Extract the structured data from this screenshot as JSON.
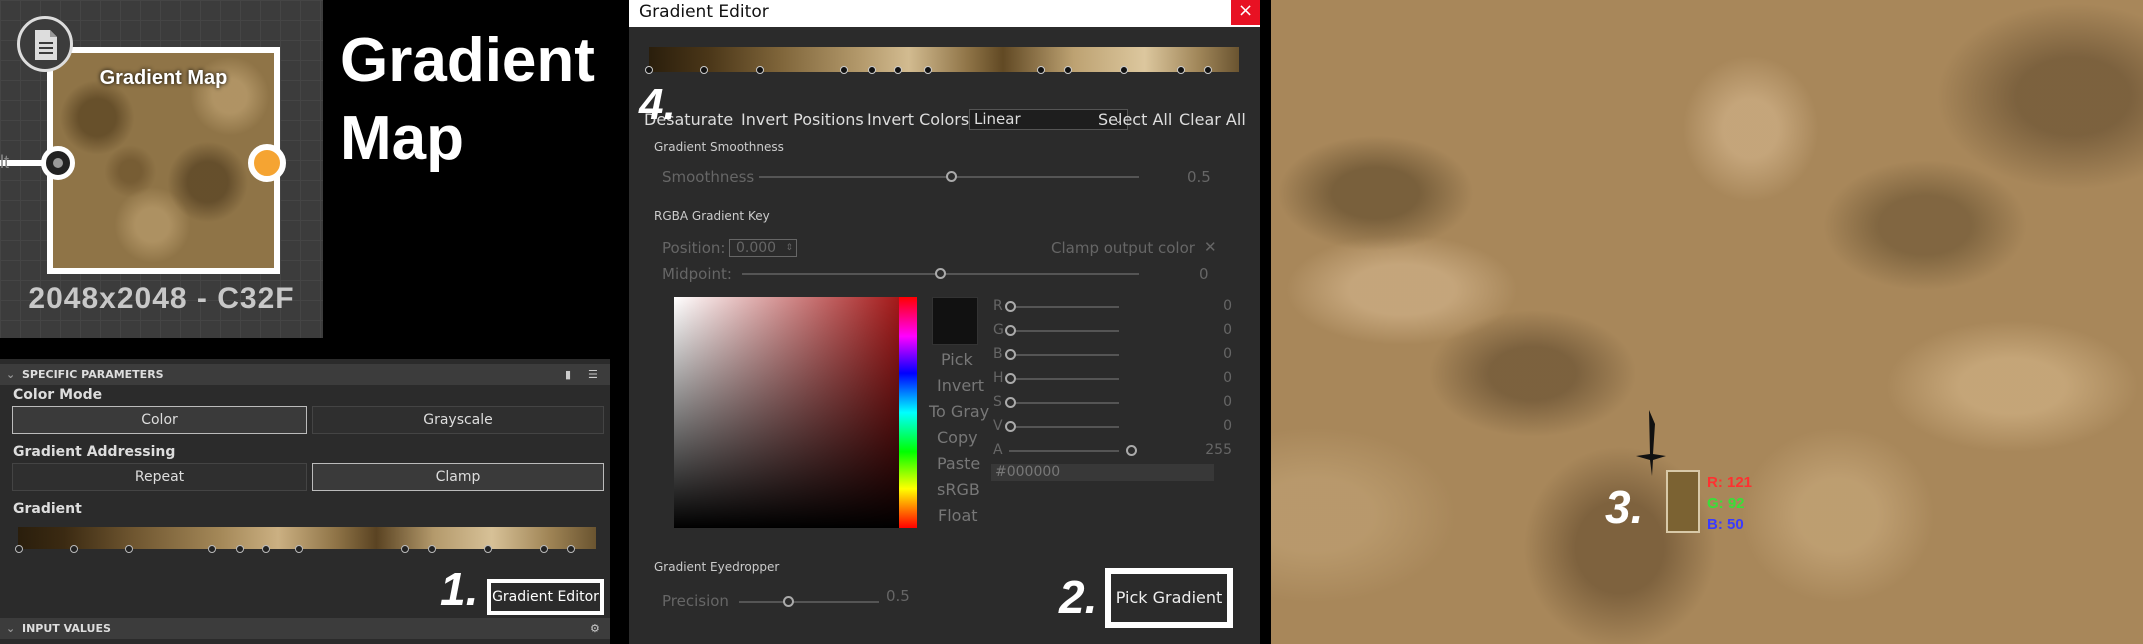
{
  "node": {
    "title": "Gradient Map",
    "size_label": "2048x2048 - C32F",
    "input_label": "lt",
    "big_title": "Gradient Map"
  },
  "props": {
    "section_specific": "SPECIFIC PARAMETERS",
    "color_mode_label": "Color Mode",
    "color_mode_options": [
      "Color",
      "Grayscale"
    ],
    "color_mode_selected": "Color",
    "addressing_label": "Gradient Addressing",
    "addressing_options": [
      "Repeat",
      "Clamp"
    ],
    "addressing_selected": "Clamp",
    "gradient_label": "Gradient",
    "gradient_editor_button": "Gradient Editor",
    "section_inputs": "INPUT VALUES"
  },
  "steps": {
    "one": "1.",
    "two": "2.",
    "three": "3.",
    "four": "4."
  },
  "editor": {
    "title": "Gradient Editor",
    "close": "×",
    "toolbar": {
      "desaturate": "Desaturate",
      "invert_positions": "Invert Positions",
      "invert_colors": "Invert Colors",
      "interpolation": "Linear",
      "select_all": "Select All",
      "clear_all": "Clear All"
    },
    "smoothness_section": "Gradient Smoothness",
    "smoothness_label": "Smoothness",
    "smoothness_value": "0.5",
    "rgba_section": "RGBA Gradient Key",
    "position_label": "Position:",
    "position_value": "0.000",
    "clamp_label": "Clamp output color",
    "clamp_x": "✕",
    "midpoint_label": "Midpoint:",
    "midpoint_value": "0",
    "side_buttons": [
      "Pick",
      "Invert",
      "To Gray",
      "Copy",
      "Paste",
      "sRGB",
      "Float"
    ],
    "channels": [
      {
        "label": "R",
        "value": "0"
      },
      {
        "label": "G",
        "value": "0"
      },
      {
        "label": "B",
        "value": "0"
      },
      {
        "label": "H",
        "value": "0"
      },
      {
        "label": "S",
        "value": "0"
      },
      {
        "label": "V",
        "value": "0"
      },
      {
        "label": "A",
        "value": "255"
      }
    ],
    "hex": "#000000",
    "eyedropper_section": "Gradient Eyedropper",
    "precision_label": "Precision",
    "precision_value": "0.5",
    "pick_gradient": "Pick Gradient"
  },
  "readout": {
    "r": "R: 121",
    "g": "G: 92",
    "b": "B: 50"
  },
  "colors": {
    "accent_orange": "#f5a432",
    "close_red": "#e81123",
    "swatch": "#7b6232"
  }
}
